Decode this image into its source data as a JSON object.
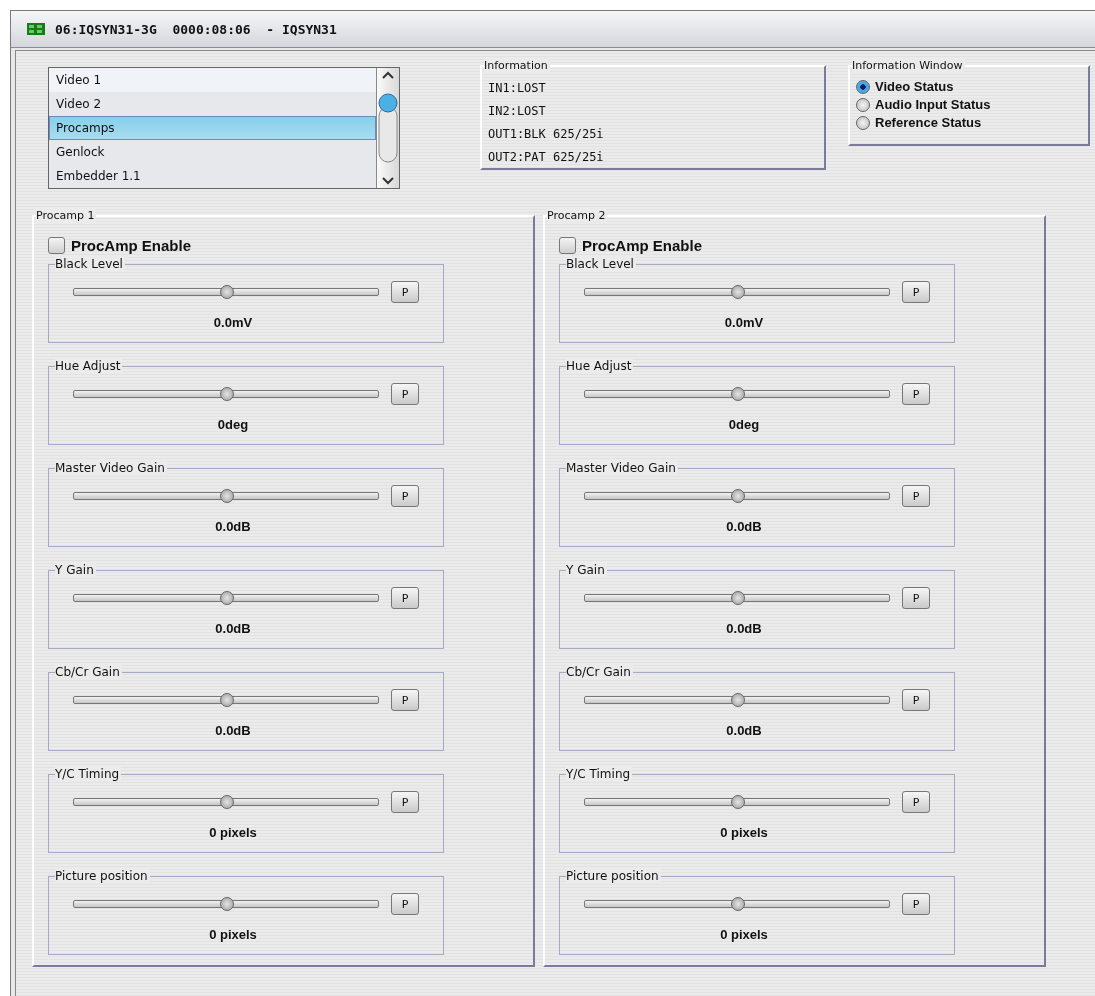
{
  "window": {
    "title": "06:IQSYN31-3G  0000:08:06  - IQSYN31"
  },
  "menu_list": {
    "items": [
      {
        "label": "Video 1",
        "selected": false
      },
      {
        "label": "Video 2",
        "selected": false
      },
      {
        "label": "Procamps",
        "selected": true
      },
      {
        "label": "Genlock",
        "selected": false
      },
      {
        "label": "Embedder 1.1",
        "selected": false
      }
    ]
  },
  "information": {
    "title": "Information",
    "lines": [
      "IN1:LOST",
      "IN2:LOST",
      "OUT1:BLK 625/25i",
      "OUT2:PAT 625/25i"
    ]
  },
  "information_window": {
    "title": "Information Window",
    "options": [
      {
        "label": "Video Status",
        "selected": true
      },
      {
        "label": "Audio Input Status",
        "selected": false
      },
      {
        "label": "Reference Status",
        "selected": false
      }
    ]
  },
  "procamps": [
    {
      "title": "Procamp 1",
      "enable": {
        "label": "ProcAmp Enable",
        "checked": false
      },
      "controls": [
        {
          "label": "Black Level",
          "level": 0.5,
          "button": "P",
          "value": "0.0mV"
        },
        {
          "label": "Hue Adjust",
          "level": 0.5,
          "button": "P",
          "value": "0deg"
        },
        {
          "label": "Master Video Gain",
          "level": 0.5,
          "button": "P",
          "value": "0.0dB"
        },
        {
          "label": "Y Gain",
          "level": 0.5,
          "button": "P",
          "value": "0.0dB"
        },
        {
          "label": "Cb/Cr Gain",
          "level": 0.5,
          "button": "P",
          "value": "0.0dB"
        },
        {
          "label": "Y/C Timing",
          "level": 0.5,
          "button": "P",
          "value": "0 pixels"
        },
        {
          "label": "Picture position",
          "level": 0.5,
          "button": "P",
          "value": "0 pixels"
        }
      ]
    },
    {
      "title": "Procamp 2",
      "enable": {
        "label": "ProcAmp Enable",
        "checked": false
      },
      "controls": [
        {
          "label": "Black Level",
          "level": 0.5,
          "button": "P",
          "value": "0.0mV"
        },
        {
          "label": "Hue Adjust",
          "level": 0.5,
          "button": "P",
          "value": "0deg"
        },
        {
          "label": "Master Video Gain",
          "level": 0.5,
          "button": "P",
          "value": "0.0dB"
        },
        {
          "label": "Y Gain",
          "level": 0.5,
          "button": "P",
          "value": "0.0dB"
        },
        {
          "label": "Cb/Cr Gain",
          "level": 0.5,
          "button": "P",
          "value": "0.0dB"
        },
        {
          "label": "Y/C Timing",
          "level": 0.5,
          "button": "P",
          "value": "0 pixels"
        },
        {
          "label": "Picture position",
          "level": 0.5,
          "button": "P",
          "value": "0 pixels"
        }
      ]
    }
  ]
}
